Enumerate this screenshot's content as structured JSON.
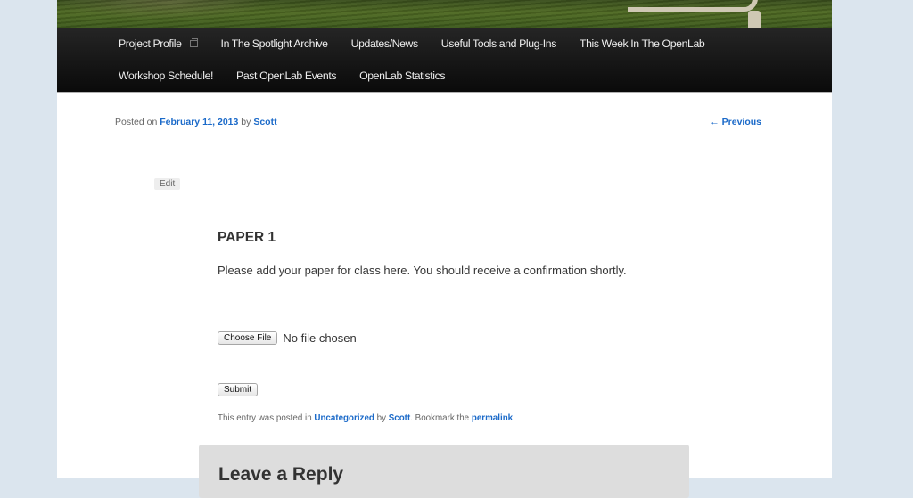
{
  "nav": {
    "items": [
      {
        "label": "Project Profile",
        "icon": "external-window-icon"
      },
      {
        "label": "In The Spotlight Archive"
      },
      {
        "label": "Updates/News"
      },
      {
        "label": "Useful Tools and Plug-Ins"
      },
      {
        "label": "This Week In The OpenLab"
      },
      {
        "label": "Workshop Schedule!"
      },
      {
        "label": "Past OpenLab Events"
      },
      {
        "label": "OpenLab Statistics"
      }
    ]
  },
  "meta": {
    "posted_on": "Posted on",
    "date": "February 11, 2013",
    "by": "by",
    "author": "Scott"
  },
  "previous_link": "← Previous",
  "edit_label": "Edit",
  "entry": {
    "title": "PAPER 1",
    "text": "Please add your paper for class here. You should receive a confirmation shortly.",
    "choose_file_label": "Choose File",
    "file_status": "No file chosen",
    "submit_label": "Submit"
  },
  "footer": {
    "prefix": "This entry was posted in",
    "category": "Uncategorized",
    "by": "by",
    "author": "Scott",
    "bookmark": ". Bookmark the",
    "permalink": "permalink",
    "end": "."
  },
  "reply": {
    "title": "Leave a Reply"
  },
  "colors": {
    "background": "#dbe5ee",
    "link": "#1b6ac9",
    "nav_bg": "#0a0a0a",
    "reply_bg": "#dddddd"
  }
}
